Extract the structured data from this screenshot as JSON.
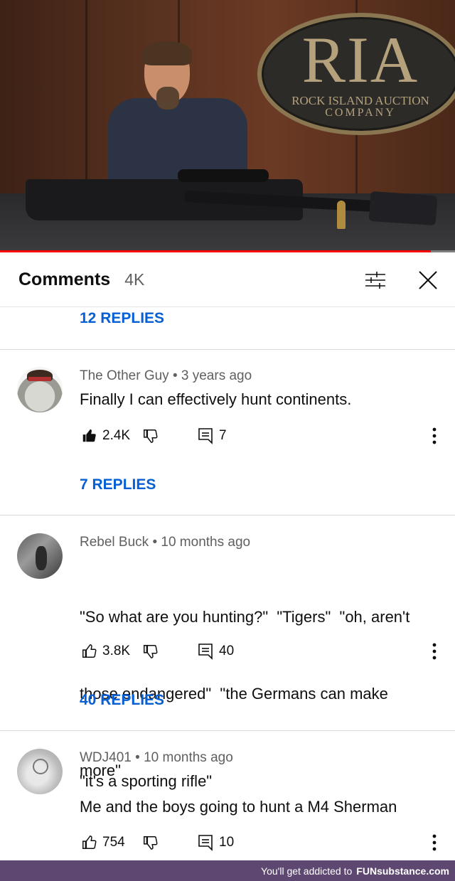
{
  "video": {
    "logo_big": "RIA",
    "logo_line1": "ROCK ISLAND AUCTION",
    "logo_line2": "COMPANY",
    "progress": 0.947,
    "progress_color": "#ff0000"
  },
  "header": {
    "title": "Comments",
    "count": "4K",
    "filter_icon": "filter-sliders-icon",
    "close_icon": "close-icon"
  },
  "top_replies_label": "12 REPLIES",
  "comments": [
    {
      "author": "The Other Guy",
      "age": "3 years ago",
      "lines": [
        "Finally I can effectively hunt continents."
      ],
      "likes": "2.4K",
      "liked": true,
      "replies_count": "7",
      "replies_label": "7 REPLIES"
    },
    {
      "author": "Rebel Buck",
      "age": "10 months ago",
      "lines": [
        "\"So what are you hunting?\"  \"Tigers\"  \"oh, aren't",
        "those endangered\"  \"the Germans can make",
        "more\""
      ],
      "likes": "3.8K",
      "liked": false,
      "replies_count": "40",
      "replies_label": "40 REPLIES"
    },
    {
      "author": "WDJ401",
      "age": "10 months ago",
      "lines": [
        "\"it's a sporting rifle\"",
        "Me and the boys going to hunt a M4 Sherman"
      ],
      "likes": "754",
      "liked": false,
      "replies_count": "10"
    }
  ],
  "separator": "•",
  "banner": {
    "text": "You'll get addicted to",
    "brand": "FUNsubstance.com",
    "color": "#5e4871"
  }
}
